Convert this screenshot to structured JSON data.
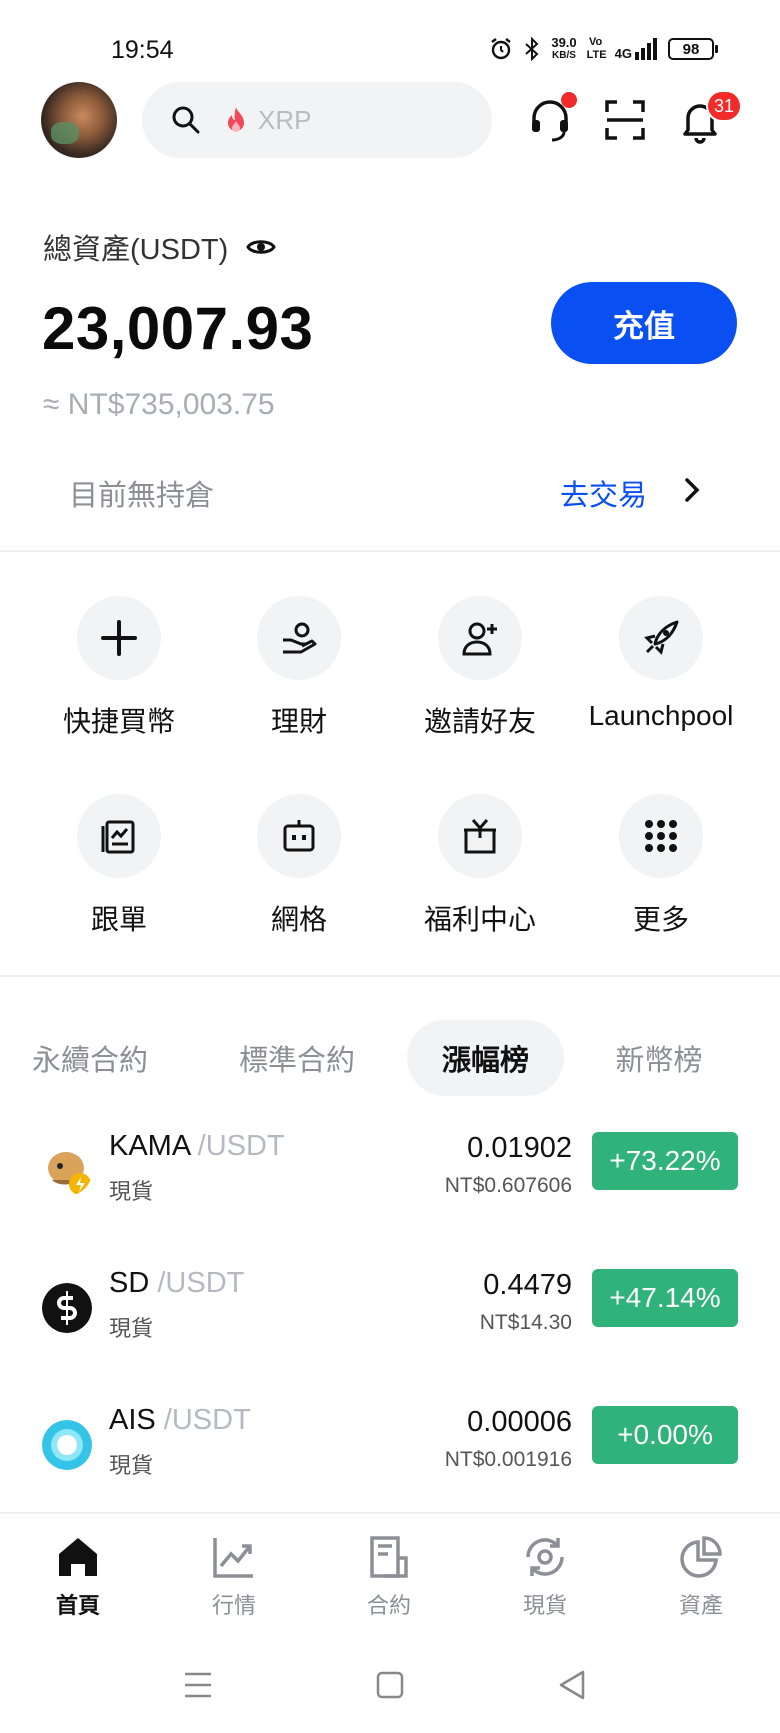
{
  "status_bar": {
    "time": "19:54",
    "net_speed_value": "39.0",
    "net_speed_unit": "KB/S",
    "volte": "Vo LTE",
    "signal": "4G",
    "battery": "98"
  },
  "header": {
    "search_placeholder": "XRP",
    "notification_count": "31",
    "icons": [
      "avatar",
      "search-icon",
      "fire-icon",
      "support-icon",
      "scan-icon",
      "bell-icon"
    ]
  },
  "assets": {
    "label": "總資產(USDT)",
    "value": "23,007.93",
    "fiat_value": "≈ NT$735,003.75",
    "deposit_label": "充值"
  },
  "positions": {
    "empty_text": "目前無持倉",
    "trade_link": "去交易"
  },
  "shortcuts": [
    {
      "label": "快捷買幣",
      "icon": "plus-icon"
    },
    {
      "label": "理財",
      "icon": "hand-coin-icon"
    },
    {
      "label": "邀請好友",
      "icon": "add-user-icon"
    },
    {
      "label": "Launchpool",
      "icon": "rocket-icon"
    },
    {
      "label": "跟單",
      "icon": "copy-trade-icon"
    },
    {
      "label": "網格",
      "icon": "robot-icon"
    },
    {
      "label": "福利中心",
      "icon": "gift-box-icon"
    },
    {
      "label": "更多",
      "icon": "grid-dots-icon"
    }
  ],
  "market_tabs": [
    {
      "label": "永續合約",
      "active": false
    },
    {
      "label": "標準合約",
      "active": false
    },
    {
      "label": "漲幅榜",
      "active": true
    },
    {
      "label": "新幣榜",
      "active": false
    }
  ],
  "coins": [
    {
      "base": "KAMA",
      "quote": " /USDT",
      "type": "現貨",
      "price": "0.01902",
      "fiat": "NT$0.607606",
      "change": "+73.22%"
    },
    {
      "base": "SD",
      "quote": " /USDT",
      "type": "現貨",
      "price": "0.4479",
      "fiat": "NT$14.30",
      "change": "+47.14%"
    },
    {
      "base": "AIS",
      "quote": " /USDT",
      "type": "現貨",
      "price": "0.00006",
      "fiat": "NT$0.001916",
      "change": "+0.00%"
    }
  ],
  "bottom_nav": [
    {
      "label": "首頁",
      "icon": "home-icon",
      "active": true
    },
    {
      "label": "行情",
      "icon": "chart-icon",
      "active": false
    },
    {
      "label": "合約",
      "icon": "contract-icon",
      "active": false
    },
    {
      "label": "現貨",
      "icon": "spot-icon",
      "active": false
    },
    {
      "label": "資產",
      "icon": "pie-icon",
      "active": false
    }
  ],
  "colors": {
    "accent_blue": "#0a4ff2",
    "gain_green": "#2fb37a",
    "badge_red": "#f12a2a",
    "muted_gray": "#8c8f96"
  }
}
